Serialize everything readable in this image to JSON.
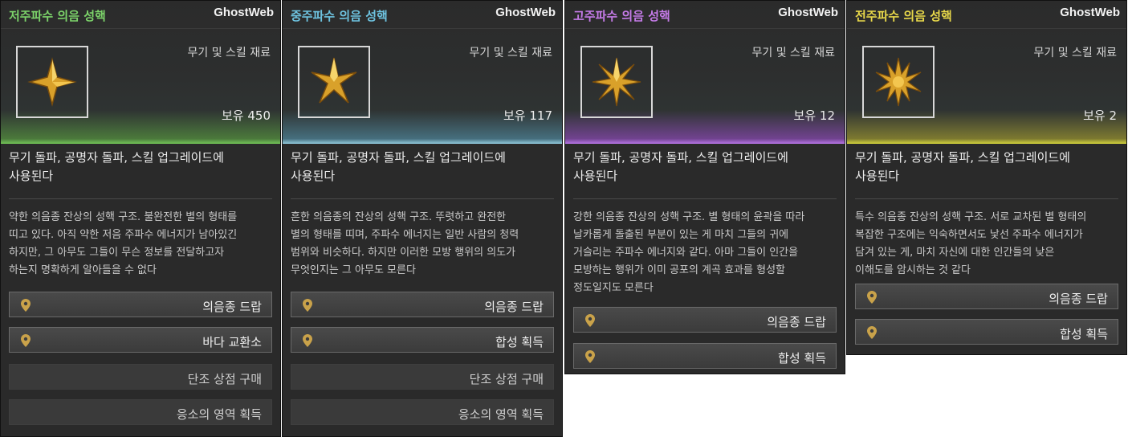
{
  "brand": "GhostWeb",
  "panels": [
    {
      "title": "저주파수 의음 성핵",
      "title_color": "#7cd36a",
      "item_type": "무기 및 스킬 재료",
      "count": "보유 450",
      "usage_lines": [
        "무기 돌파, 공명자 돌파, 스킬 업그레이드에",
        "사용된다"
      ],
      "description": [
        "약한 의음종 잔상의 성핵 구조. 불완전한 별의 형태를",
        "띠고 있다. 아직 약한 저음 주파수 에너지가 남아있긴",
        "하지만, 그 아무도 그들이 무슨 정보를 전달하고자",
        "하는지 명확하게 알아들을 수 없다"
      ],
      "sources": [
        {
          "label": "의음종 드랍",
          "pin": true
        },
        {
          "label": "바다 교환소",
          "pin": true
        },
        {
          "label": "단조 상점 구매",
          "pin": false
        },
        {
          "label": "응소의 영역 획득",
          "pin": false
        }
      ]
    },
    {
      "title": "중주파수 의음 성핵",
      "title_color": "#6ec3e0",
      "item_type": "무기 및 스킬 재료",
      "count": "보유 117",
      "usage_lines": [
        "무기 돌파, 공명자 돌파, 스킬 업그레이드에",
        "사용된다"
      ],
      "description": [
        "흔한 의음종의 잔상의 성핵 구조. 뚜렷하고 완전한",
        "별의 형태를 띠며, 주파수 에너지는 일반 사람의 청력",
        "범위와 비슷하다. 하지만 이러한 모방 행위의 의도가",
        "무엇인지는 그 아무도 모른다"
      ],
      "sources": [
        {
          "label": "의음종 드랍",
          "pin": true
        },
        {
          "label": "합성 획득",
          "pin": true
        },
        {
          "label": "단조 상점 구매",
          "pin": false
        },
        {
          "label": "응소의 영역 획득",
          "pin": false
        }
      ]
    },
    {
      "title": "고주파수 의음 성핵",
      "title_color": "#c57be8",
      "item_type": "무기 및 스킬 재료",
      "count": "보유 12",
      "usage_lines": [
        "무기 돌파, 공명자 돌파, 스킬 업그레이드에",
        "사용된다"
      ],
      "description": [
        "강한 의음종 잔상의 성핵 구조. 별 형태의 윤곽을 따라",
        "날카롭게 돌출된 부분이 있는 게 마치 그들의 귀에",
        "거슬리는 주파수 에너지와 같다. 아마 그들이 인간을",
        "모방하는 행위가 이미 공포의 계곡 효과를 형성할",
        "정도일지도 모른다"
      ],
      "sources": [
        {
          "label": "의음종 드랍",
          "pin": true
        },
        {
          "label": "합성 획득",
          "pin": true
        }
      ]
    },
    {
      "title": "전주파수 의음 성핵",
      "title_color": "#e8d84a",
      "item_type": "무기 및 스킬 재료",
      "count": "보유 2",
      "usage_lines": [
        "무기 돌파, 공명자 돌파, 스킬 업그레이드에",
        "사용된다"
      ],
      "description": [
        "특수 의음종 잔상의 성핵 구조. 서로 교차된 별 형태의",
        "복잡한 구조에는 익숙하면서도 낯선 주파수 에너지가",
        "담겨 있는 게, 마치 자신에 대한 인간들의 낮은",
        "이해도를 암시하는 것 같다"
      ],
      "sources": [
        {
          "label": "의음종 드랍",
          "pin": true
        },
        {
          "label": "합성 획득",
          "pin": true
        }
      ]
    }
  ]
}
